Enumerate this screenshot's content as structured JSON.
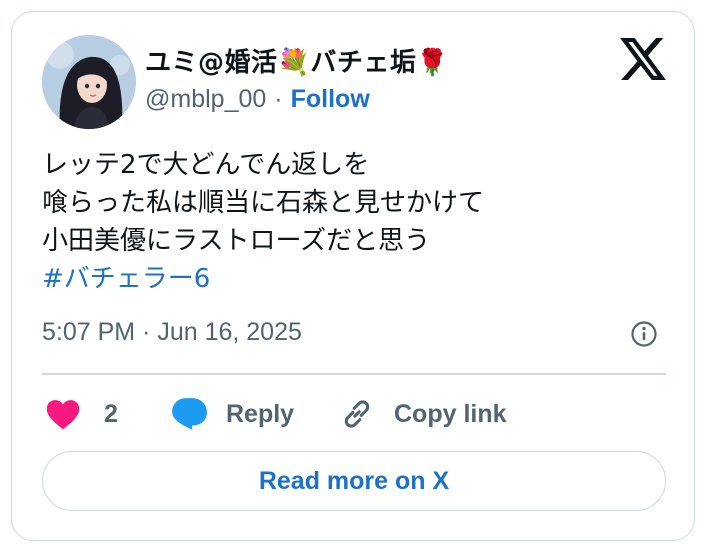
{
  "author": {
    "display_name": "ユミ@婚活💐バチェ垢🌹",
    "handle": "@mblp_00",
    "separator": "·",
    "follow_label": "Follow"
  },
  "tweet": {
    "lines": [
      "レッテ2で大どんでん返しを",
      "喰らった私は順当に石森と見せかけて",
      "小田美優にラストローズだと思う"
    ],
    "hashtag": "#バチェラー6",
    "timestamp": "5:07 PM · Jun 16, 2025"
  },
  "actions": {
    "like_count": "2",
    "reply_label": "Reply",
    "copy_label": "Copy link"
  },
  "read_more_label": "Read more on X",
  "icons": [
    "x-logo-icon",
    "info-icon",
    "heart-icon",
    "speech-bubble-icon",
    "link-icon"
  ],
  "colors": {
    "link_blue": "#1d71c6",
    "heart_pink": "#f91880",
    "reply_blue": "#1d9bf0",
    "muted_text": "#536471",
    "border": "#cfd9de"
  }
}
